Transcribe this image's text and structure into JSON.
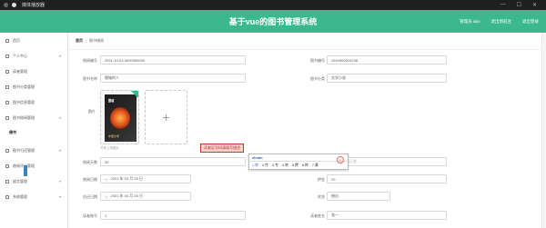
{
  "titlebar": {
    "title": "媒体播放器",
    "minimize": "—",
    "maximize": "☐",
    "close": "✕"
  },
  "header": {
    "title": "基于vue的图书管理系统",
    "nav": [
      "管理员 abo",
      "退出到前台",
      "退出登录"
    ]
  },
  "sidebar": {
    "items": [
      {
        "label": "首页",
        "icon": "home-icon",
        "type": "item"
      },
      {
        "label": "个人中心",
        "icon": "user-icon",
        "type": "item",
        "chevron": "▾"
      },
      {
        "label": "读者管理",
        "icon": "reader-icon",
        "type": "item"
      },
      {
        "label": "图书分类管理",
        "icon": "category-icon",
        "type": "item"
      },
      {
        "label": "图书信息管理",
        "icon": "book-icon",
        "type": "item"
      },
      {
        "label": "图书借阅管理",
        "icon": "borrow-icon",
        "type": "item",
        "chevron": "▾"
      },
      {
        "label": "借书",
        "icon": "",
        "type": "sub-active"
      },
      {
        "label": "图书归还管理",
        "icon": "return-icon",
        "type": "item",
        "chevron": "▾"
      },
      {
        "label": "借阅评分管理",
        "icon": "rating-icon",
        "type": "item"
      },
      {
        "label": "留言管理",
        "icon": "message-icon",
        "type": "item",
        "chevron": "▾"
      },
      {
        "label": "系统管理",
        "icon": "settings-icon",
        "type": "item",
        "chevron": "▾"
      }
    ]
  },
  "breadcrumb": {
    "home": "首页",
    "sep": "/",
    "current": "图书借阅"
  },
  "form": {
    "borrow_no_label": "借阅编号",
    "borrow_no_value": "2021-10-03-0000000000",
    "book_no_label": "图书编号",
    "book_no_value": "1910900010238",
    "book_name_label": "图书名称",
    "book_name_value": "围城的人",
    "category_label": "图书分类",
    "category_value": "文学小说",
    "cover_label": "图片",
    "cover_book_title": "围城",
    "cover_book_subtitle": "中国文学",
    "upload_plus": "+",
    "hint": "书本上传图片",
    "borrow_days_label": "借阅天数",
    "borrow_days_value": "30",
    "borrow_days_right_value": "请输入借阅天数",
    "borrow_date_label": "借阅日期",
    "borrow_date_value": "2021 年 03 月 25 日",
    "deposit_label": "押金",
    "deposit_value": "20",
    "return_date_label": "应还日期",
    "return_date_value": "2021 年 04 月 25 日",
    "status_label": "状态",
    "status_value": "借出",
    "reader_no_label": "读者账号",
    "reader_no_value": "1",
    "reader_name_label": "读者姓名",
    "reader_name_value": "张一"
  },
  "tooltip": "读者证号码请填写描述",
  "ime": {
    "composition": "zhuan",
    "candidates": [
      "1.转",
      "2.传",
      "3.专",
      "4.转",
      "5.撰",
      "6.砖",
      "7.篆"
    ],
    "logo": "S"
  },
  "colors": {
    "header": "#3bb88d",
    "error": "#c0392b"
  }
}
